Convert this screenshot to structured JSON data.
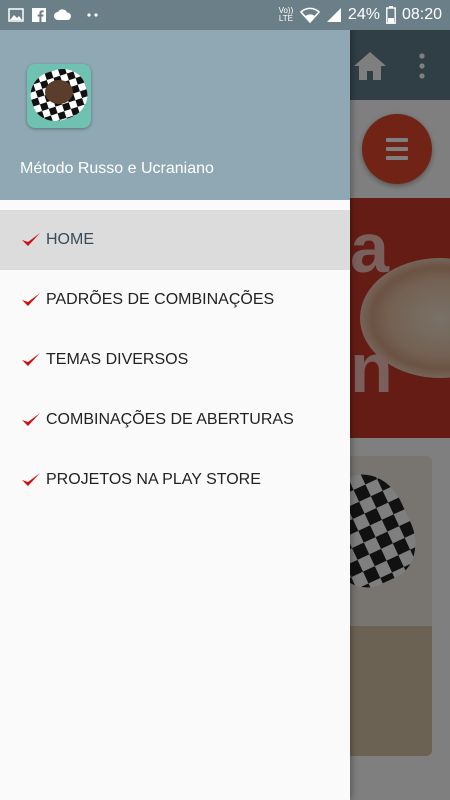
{
  "status_bar": {
    "notification_icons": [
      "image-icon",
      "facebook-icon",
      "cloud-icon",
      "more-dots-icon"
    ],
    "network": "Vo)) LTE",
    "battery": "24%",
    "time": "08:20"
  },
  "drawer": {
    "app_name": "Método Russo e Ucraniano",
    "items": [
      {
        "label": "HOME",
        "active": true
      },
      {
        "label": "PADRÕES DE COMBINAÇÕES",
        "active": false
      },
      {
        "label": "TEMAS DIVERSOS",
        "active": false
      },
      {
        "label": "COMBINAÇÕES DE ABERTURAS",
        "active": false
      },
      {
        "label": "PROJETOS NA PLAY STORE",
        "active": false
      }
    ]
  },
  "colors": {
    "toolbar": "#607d8b",
    "drawer_header": "#8fa8b3",
    "check": "#cc1111",
    "fab": "#e2492a"
  }
}
